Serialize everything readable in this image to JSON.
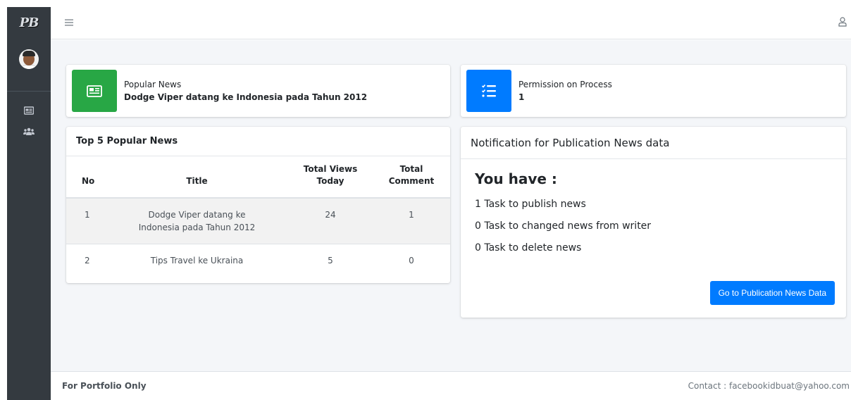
{
  "brand": {
    "logo_text": "PB"
  },
  "sidebar": {
    "items": [
      {
        "icon": "newspaper-icon"
      },
      {
        "icon": "users-icon"
      }
    ]
  },
  "header": {
    "menu_icon": "hamburger-icon",
    "user_icon": "user-icon"
  },
  "info_boxes": {
    "popular_news": {
      "label": "Popular News",
      "value": "Dodge Viper datang ke Indonesia pada Tahun 2012",
      "color": "#28a745",
      "icon": "newspaper-icon"
    },
    "permission": {
      "label": "Permission on Process",
      "value": "1",
      "color": "#007bff",
      "icon": "task-list-icon"
    }
  },
  "popular_table": {
    "title": "Top 5 Popular News",
    "headers": {
      "no": "No",
      "title": "Title",
      "views": "Total Views Today",
      "comments": "Total Comment"
    },
    "rows": [
      {
        "no": "1",
        "title": "Dodge Viper datang ke Indonesia pada Tahun 2012",
        "views": "24",
        "comments": "1"
      },
      {
        "no": "2",
        "title": "Tips Travel ke Ukraina",
        "views": "5",
        "comments": "0"
      }
    ]
  },
  "notification": {
    "title": "Notification for Publication News data",
    "heading": "You have :",
    "tasks": [
      "1 Task to publish news",
      "0 Task to changed news from writer",
      "0 Task to delete news"
    ],
    "button_label": "Go to Publication News Data"
  },
  "footer": {
    "left": "For Portfolio Only",
    "right": "Contact : facebookidbuat@yahoo.com"
  }
}
